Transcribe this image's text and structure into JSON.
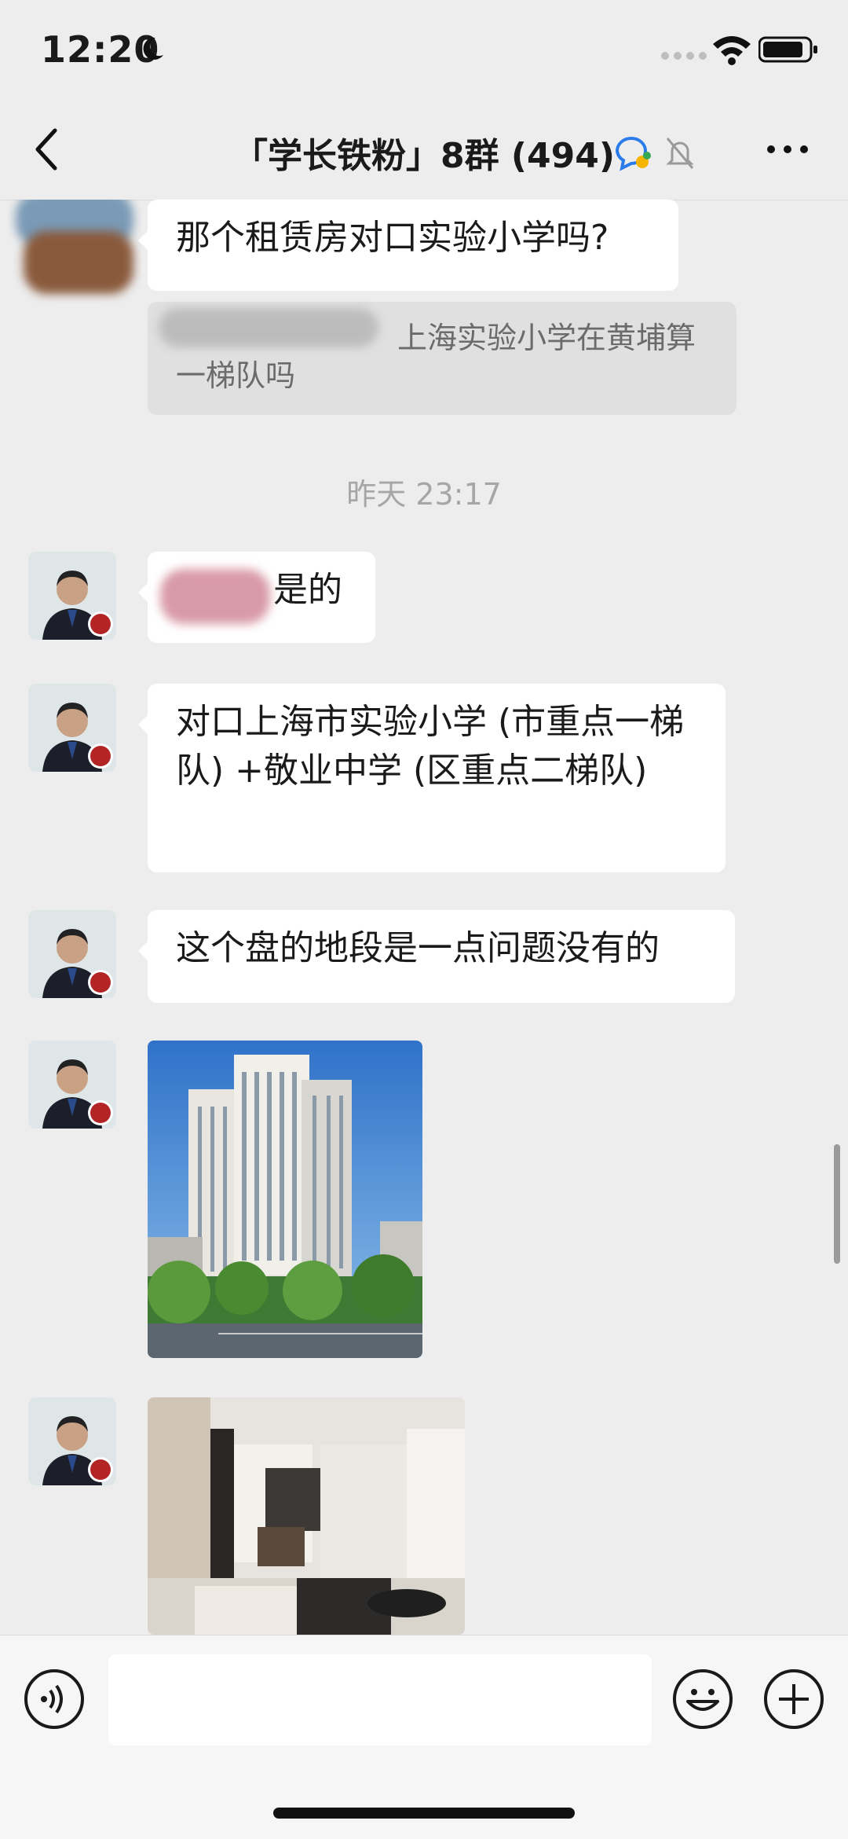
{
  "status_bar": {
    "time": "12:20"
  },
  "nav": {
    "title": "「学长铁粉」8群 (494)"
  },
  "chat": {
    "top_message": "那个租赁房对口实验小学吗?",
    "quote_text": "上海实验小学在黄埔算一梯队吗",
    "timestamp": "昨天 23:17",
    "reply_suffix": "是的",
    "message_2": "对口上海市实验小学 (市重点一梯队) +敬业中学 (区重点二梯队)",
    "message_3": "这个盘的地段是一点问题没有的"
  },
  "input": {
    "placeholder": ""
  },
  "colors": {
    "background": "#ededed",
    "bubble": "#ffffff",
    "quote_bg": "#e0e0e0",
    "timestamp": "#a6a6a6"
  }
}
